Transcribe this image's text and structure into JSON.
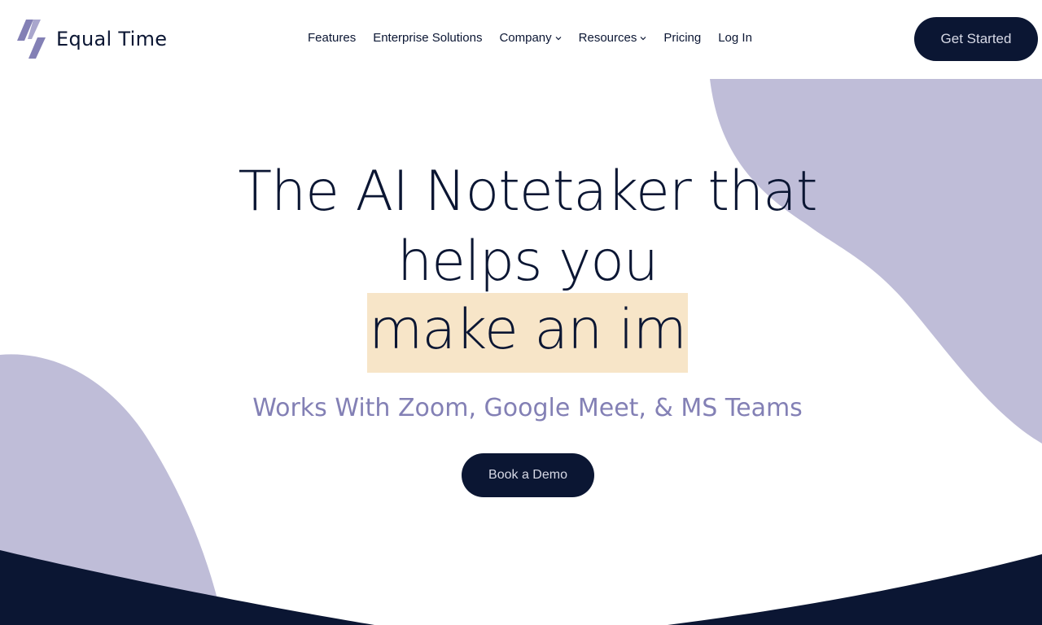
{
  "brand": {
    "name": "Equal Time",
    "logo_icon": "equal-time-slash-icon"
  },
  "nav": {
    "items": [
      {
        "label": "Features",
        "has_dropdown": false
      },
      {
        "label": "Enterprise Solutions",
        "has_dropdown": false
      },
      {
        "label": "Company",
        "has_dropdown": true
      },
      {
        "label": "Resources",
        "has_dropdown": true
      },
      {
        "label": "Pricing",
        "has_dropdown": false
      },
      {
        "label": "Log In",
        "has_dropdown": false
      }
    ],
    "cta_label": "Get Started"
  },
  "hero": {
    "headline_line1": "The AI Notetaker that",
    "headline_line2": "helps you",
    "headline_line3": "make an im",
    "subheadline": "Works With Zoom, Google Meet, & MS Teams",
    "cta_label": "Book a Demo"
  },
  "colors": {
    "navy": "#0b1633",
    "lavender": "#bfbdd8",
    "subhead_purple": "#8380b5",
    "highlight": "#f7e5c8"
  }
}
